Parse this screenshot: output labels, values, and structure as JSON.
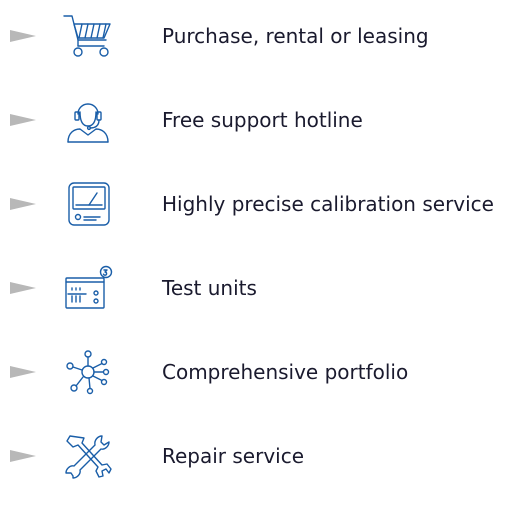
{
  "accent_color": "#1a5ea8",
  "bullet_color": "#b8b8b8",
  "items": [
    {
      "label": "Purchase, rental or leasing",
      "icon": "shopping-cart-icon"
    },
    {
      "label": "Free support hotline",
      "icon": "headset-support-icon"
    },
    {
      "label": "Highly precise calibration service",
      "icon": "meter-gauge-icon"
    },
    {
      "label": "Test units",
      "icon": "test-device-icon"
    },
    {
      "label": "Comprehensive portfolio",
      "icon": "network-hub-icon"
    },
    {
      "label": "Repair service",
      "icon": "wrench-screwdriver-icon"
    }
  ]
}
